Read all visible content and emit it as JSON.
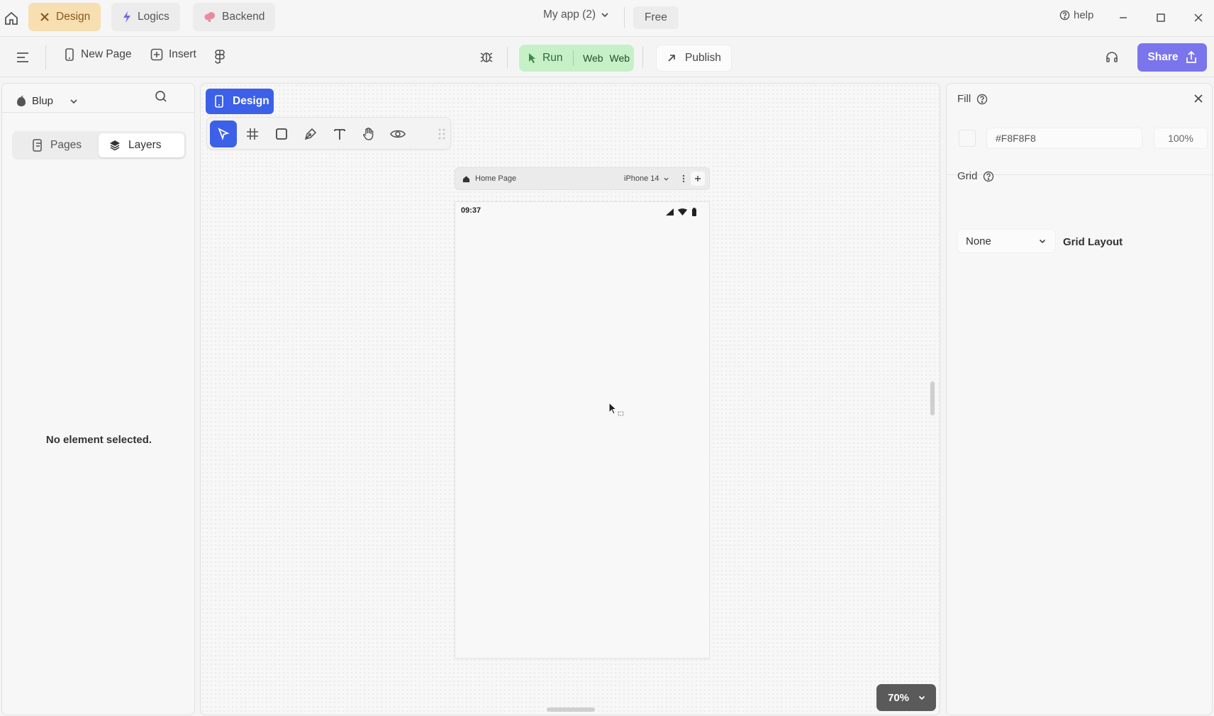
{
  "titlebar": {
    "tabs": [
      {
        "label": "Design",
        "icon": "design-x-icon",
        "active": true
      },
      {
        "label": "Logics",
        "icon": "lightning-icon",
        "active": false
      },
      {
        "label": "Backend",
        "icon": "cloud-icon",
        "active": false
      }
    ],
    "app_name": "My app (2)",
    "plan": "Free",
    "help": "help"
  },
  "toolbar": {
    "new_page": "New Page",
    "insert": "Insert",
    "run": "Run",
    "web_1": "Web",
    "web_2": "Web",
    "publish": "Publish",
    "share": "Share"
  },
  "left_panel": {
    "project": "Blup",
    "tabs": [
      {
        "label": "Pages",
        "active": false
      },
      {
        "label": "Layers",
        "active": true
      }
    ],
    "empty_message": "No element selected."
  },
  "canvas": {
    "mode_chip": "Design",
    "tools": [
      "select-tool",
      "frame-grid-tool",
      "rectangle-tool",
      "pen-tool",
      "text-tool",
      "hand-tool",
      "preview-tool"
    ],
    "frame_bar": {
      "page_name": "Home Page",
      "device": "iPhone 14"
    },
    "status_time": "09:37",
    "zoom": "70%"
  },
  "right_panel": {
    "fill": {
      "title": "Fill",
      "hex": "#F8F8F8",
      "opacity": "100%"
    },
    "grid": {
      "title": "Grid",
      "select_value": "None",
      "layout_label": "Grid Layout"
    }
  },
  "colors": {
    "accent_blue": "#3d60e8",
    "share_purple": "#7a75ec",
    "run_green": "#c6f0c8",
    "design_tab": "#f7dfb2"
  }
}
